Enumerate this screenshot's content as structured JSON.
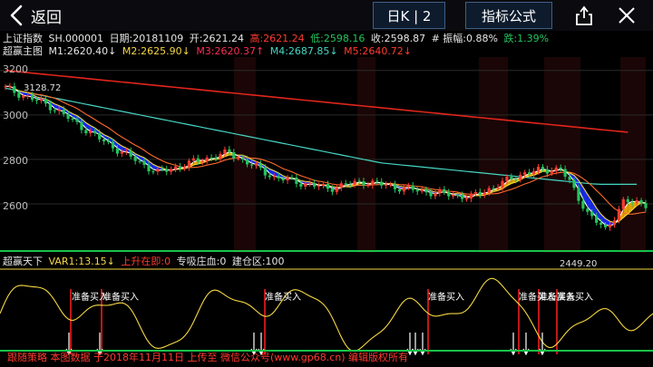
{
  "nav": {
    "back_label": "返回",
    "period_label": "日K | 2",
    "indicator_label": "指标公式"
  },
  "icons": {
    "back": "chevron-left-icon",
    "share": "share-icon",
    "close": "close-icon"
  },
  "info": {
    "index_name": "上证指数",
    "code": "SH.000001",
    "date": "日期:20181109",
    "open": "开:2621.24",
    "high": "高:2621.24",
    "low": "低:2598.16",
    "close": "收:2598.87",
    "amplitude": "# 振幅:0.88%",
    "change": "跌:1.39%"
  },
  "ma_line": {
    "title": "超赢主图",
    "m1": "M1:2620.40↓",
    "m2": "M2:2625.90↓",
    "m3": "M3:2620.37↑",
    "m4": "M4:2687.85↓",
    "m5": "M5:2640.72↓"
  },
  "sub_line": {
    "title": "超赢天下",
    "var1": "VAR1:13.15↓",
    "shang": "上升在即:0",
    "zhuan": "专吸庄血:0",
    "jian": "建仓区:100"
  },
  "annotations": {
    "high": "3128.72",
    "low": "2449.20"
  },
  "signals": [
    "准备买入",
    "准备买入",
    "准备买入",
    "准备买入",
    "准备买入",
    "准备买入",
    "准备买入"
  ],
  "watermark": "跟随策略 本图数据 于2018年11月11日 上传至 微信公众号(www.gp68.cn) 编辑版权所有",
  "colors": {
    "bg": "#000000",
    "up": "#ff3b30",
    "down": "#22c55e",
    "m1": "#ffffff",
    "m2": "#f5d742",
    "m3": "#ff2d55",
    "m4": "#46d6c4",
    "m5": "#e0251c",
    "wave": "#f5d742",
    "band_down": "#1b2cff",
    "band_up": "#f5b400"
  },
  "chart_data": {
    "type": "line",
    "title": "超赢主图",
    "y_ticks": [
      3200,
      3000,
      2800,
      2600
    ],
    "ylim": [
      2380,
      3260
    ],
    "x_count": 144,
    "series": [
      {
        "name": "M4",
        "values": [
          3120,
          3116,
          3112,
          3108,
          3104,
          3100,
          3096,
          3092,
          3088,
          3084,
          3080,
          3076,
          3072,
          3068,
          3064,
          3060,
          3056,
          3052,
          3048,
          3044,
          3040,
          3036,
          3032,
          3028,
          3024,
          3020,
          3016,
          3012,
          3008,
          3004,
          3000,
          2996,
          2992,
          2988,
          2984,
          2980,
          2976,
          2972,
          2968,
          2964,
          2960,
          2956,
          2952,
          2948,
          2944,
          2940,
          2936,
          2932,
          2928,
          2924,
          2920,
          2916,
          2912,
          2908,
          2904,
          2900,
          2896,
          2892,
          2888,
          2884,
          2880,
          2876,
          2872,
          2868,
          2864,
          2860,
          2856,
          2852,
          2848,
          2844,
          2840,
          2836,
          2832,
          2828,
          2824,
          2820,
          2816,
          2812,
          2808,
          2804,
          2800,
          2796,
          2792,
          2788,
          2784,
          2782,
          2780,
          2778,
          2776,
          2774,
          2772,
          2770,
          2768,
          2766,
          2764,
          2762,
          2760,
          2758,
          2756,
          2754,
          2752,
          2750,
          2748,
          2746,
          2744,
          2742,
          2740,
          2738,
          2736,
          2734,
          2732,
          2730,
          2728,
          2726,
          2724,
          2722,
          2720,
          2718,
          2716,
          2714,
          2712,
          2710,
          2708,
          2706,
          2704,
          2702,
          2700,
          2698,
          2696,
          2694,
          2692,
          2690,
          2689,
          2688,
          2688,
          2688,
          2688,
          2688,
          2688,
          2688,
          2688,
          2688
        ]
      },
      {
        "name": "M5",
        "values": [
          3200,
          3198,
          3196,
          3194,
          3192,
          3190,
          3188,
          3186,
          3184,
          3182,
          3180,
          3178,
          3176,
          3174,
          3172,
          3170,
          3168,
          3166,
          3164,
          3162,
          3160,
          3158,
          3156,
          3154,
          3152,
          3150,
          3148,
          3146,
          3144,
          3142,
          3140,
          3138,
          3136,
          3134,
          3132,
          3130,
          3128,
          3126,
          3124,
          3122,
          3120,
          3118,
          3116,
          3114,
          3112,
          3110,
          3108,
          3106,
          3104,
          3102,
          3100,
          3098,
          3096,
          3094,
          3092,
          3090,
          3088,
          3086,
          3084,
          3082,
          3080,
          3078,
          3076,
          3074,
          3072,
          3070,
          3068,
          3066,
          3064,
          3062,
          3060,
          3058,
          3056,
          3054,
          3052,
          3050,
          3048,
          3046,
          3044,
          3042,
          3040,
          3038,
          3036,
          3034,
          3032,
          3030,
          3028,
          3026,
          3024,
          3022,
          3020,
          3018,
          3016,
          3014,
          3012,
          3010,
          3008,
          3006,
          3004,
          3002,
          3000,
          2998,
          2996,
          2994,
          2992,
          2990,
          2988,
          2986,
          2984,
          2982,
          2980,
          2978,
          2976,
          2974,
          2972,
          2970,
          2968,
          2966,
          2964,
          2962,
          2960,
          2958,
          2956,
          2954,
          2952,
          2950,
          2948,
          2946,
          2944,
          2942,
          2940,
          2938,
          2936,
          2934,
          2932,
          2930,
          2928,
          2926,
          2924,
          2922
        ]
      }
    ]
  }
}
